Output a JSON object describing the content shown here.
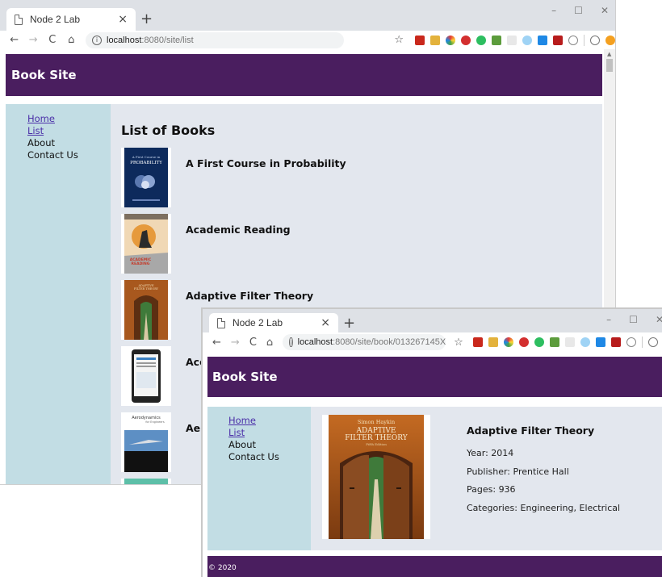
{
  "window_list": {
    "tab_title": "Node 2 Lab",
    "tab_close": "×",
    "new_tab": "+",
    "controls": {
      "minimize": "–",
      "maximize": "☐",
      "close": "✕"
    },
    "url_host": "localhost",
    "url_path": ":8080/site/list",
    "site_title": "Book Site",
    "nav": {
      "home": "Home",
      "list": "List",
      "about": "About",
      "contact": "Contact Us"
    },
    "heading": "List of Books",
    "books": [
      {
        "title": "A First Course in Probability"
      },
      {
        "title": "Academic Reading"
      },
      {
        "title": "Adaptive Filter Theory"
      },
      {
        "title": "Acc"
      },
      {
        "title": "Aer"
      }
    ]
  },
  "window_detail": {
    "tab_title": "Node 2 Lab",
    "tab_close": "×",
    "new_tab": "+",
    "controls": {
      "minimize": "–",
      "maximize": "☐",
      "close": "✕"
    },
    "url_host": "localhost",
    "url_path": ":8080/site/book/013267145X",
    "site_title": "Book Site",
    "nav": {
      "home": "Home",
      "list": "List",
      "about": "About",
      "contact": "Contact Us"
    },
    "book": {
      "title": "Adaptive Filter Theory",
      "year": "Year: 2014",
      "publisher": "Publisher: Prentice Hall",
      "pages": "Pages: 936",
      "categories": "Categories: Engineering, Electrical"
    },
    "cover": {
      "author": "Simon Haykin",
      "title_line1": "ADAPTIVE",
      "title_line2": "FILTER THEORY",
      "edition": "Fifth Edition"
    },
    "footer": "© 2020"
  },
  "colors": {
    "header": "#4a1e5f",
    "sidebar": "#c2dde4",
    "main": "#e3e7ee",
    "link": "#4b2fa8"
  },
  "covers_list": {
    "probability": {
      "line1": "A First Course in",
      "line2": "PROBABILITY"
    },
    "academic": {
      "line1": "ACADEMIC",
      "line2": "READING"
    },
    "adaptive": {
      "line1": "ADAPTIVE",
      "line2": "FILTER THEORY"
    },
    "aero": {
      "line1": "Aerodynamics",
      "line2": "for Engineers"
    }
  },
  "icons": {
    "back": "←",
    "forward": "→",
    "reload": "C",
    "home": "⌂",
    "star": "☆",
    "info": "i"
  }
}
